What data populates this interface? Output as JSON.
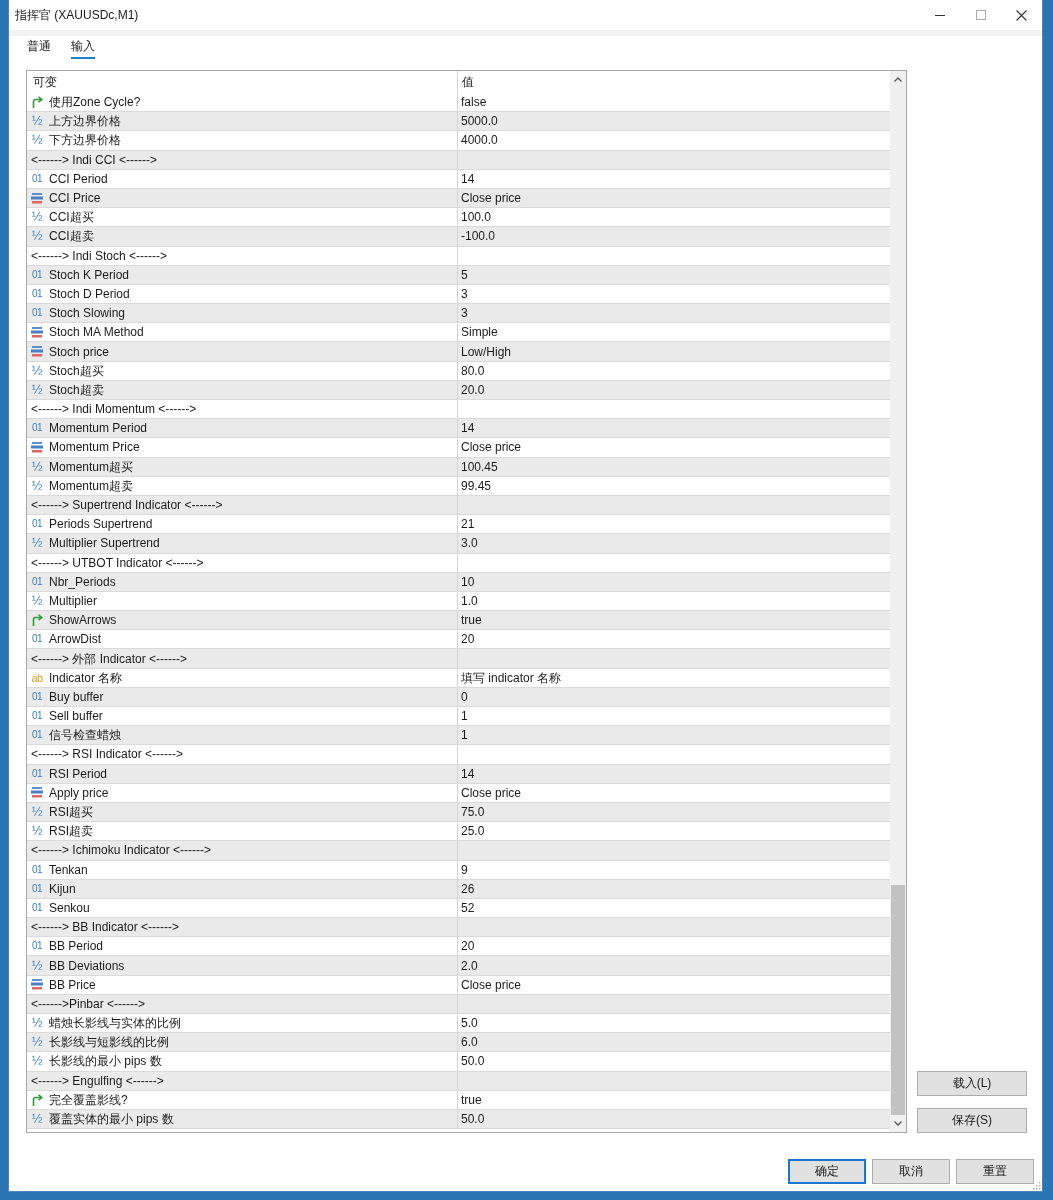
{
  "window": {
    "title": "指挥官 (XAUUSDc,M1)"
  },
  "tabs": [
    {
      "label": "普通",
      "selected": false
    },
    {
      "label": "输入",
      "selected": true
    }
  ],
  "inputs_table": {
    "columns": [
      "可变",
      "值"
    ],
    "rows": [
      {
        "kind": "bool",
        "name": "使用Zone Cycle?",
        "value": "false"
      },
      {
        "kind": "double",
        "icon": "½",
        "name": "上方边界价格",
        "value": "5000.0"
      },
      {
        "kind": "double",
        "icon": "½",
        "name": "下方边界价格",
        "value": "4000.0"
      },
      {
        "kind": "separator",
        "name": "<------> Indi CCI <------>"
      },
      {
        "kind": "int",
        "icon": "01",
        "name": "CCI Period",
        "value": "14"
      },
      {
        "kind": "enum",
        "name": "CCI Price",
        "value": "Close price"
      },
      {
        "kind": "double",
        "icon": "½",
        "name": "CCI超买",
        "value": "100.0"
      },
      {
        "kind": "double",
        "icon": "½",
        "name": "CCI超卖",
        "value": "-100.0"
      },
      {
        "kind": "separator",
        "name": "<------> Indi Stoch <------>"
      },
      {
        "kind": "int",
        "icon": "01",
        "name": "Stoch K Period",
        "value": "5"
      },
      {
        "kind": "int",
        "icon": "01",
        "name": "Stoch D Period",
        "value": "3"
      },
      {
        "kind": "int",
        "icon": "01",
        "name": "Stoch Slowing",
        "value": "3"
      },
      {
        "kind": "enum",
        "name": "Stoch MA Method",
        "value": "Simple"
      },
      {
        "kind": "enum",
        "name": "Stoch price",
        "value": "Low/High"
      },
      {
        "kind": "double",
        "icon": "½",
        "name": "Stoch超买",
        "value": "80.0"
      },
      {
        "kind": "double",
        "icon": "½",
        "name": "Stoch超卖",
        "value": "20.0"
      },
      {
        "kind": "separator",
        "name": "<------> Indi Momentum <------>"
      },
      {
        "kind": "int",
        "icon": "01",
        "name": "Momentum Period",
        "value": "14"
      },
      {
        "kind": "enum",
        "name": "Momentum Price",
        "value": "Close price"
      },
      {
        "kind": "double",
        "icon": "½",
        "name": "Momentum超买",
        "value": "100.45"
      },
      {
        "kind": "double",
        "icon": "½",
        "name": "Momentum超卖",
        "value": "99.45"
      },
      {
        "kind": "separator",
        "name": "<------> Supertrend Indicator <------>"
      },
      {
        "kind": "int",
        "icon": "01",
        "name": "Periods Supertrend",
        "value": "21"
      },
      {
        "kind": "double",
        "icon": "½",
        "name": "Multiplier Supertrend",
        "value": "3.0"
      },
      {
        "kind": "separator",
        "name": "<------> UTBOT Indicator <------>"
      },
      {
        "kind": "int",
        "icon": "01",
        "name": "Nbr_Periods",
        "value": "10"
      },
      {
        "kind": "double",
        "icon": "½",
        "name": "Multiplier",
        "value": "1.0"
      },
      {
        "kind": "bool",
        "name": "ShowArrows",
        "value": "true"
      },
      {
        "kind": "int",
        "icon": "01",
        "name": "ArrowDist",
        "value": "20"
      },
      {
        "kind": "separator",
        "name": "<------> 外部 Indicator <------>"
      },
      {
        "kind": "string",
        "icon": "ab",
        "name": "Indicator 名称",
        "value": "填写 indicator 名称"
      },
      {
        "kind": "int",
        "icon": "01",
        "name": "Buy buffer",
        "value": "0"
      },
      {
        "kind": "int",
        "icon": "01",
        "name": "Sell buffer",
        "value": "1"
      },
      {
        "kind": "int",
        "icon": "01",
        "name": "信号检查蜡烛",
        "value": "1"
      },
      {
        "kind": "separator",
        "name": "<------> RSI Indicator <------>"
      },
      {
        "kind": "int",
        "icon": "01",
        "name": "RSI Period",
        "value": "14"
      },
      {
        "kind": "enum",
        "name": "Apply price",
        "value": "Close price"
      },
      {
        "kind": "double",
        "icon": "½",
        "name": "RSI超买",
        "value": "75.0"
      },
      {
        "kind": "double",
        "icon": "½",
        "name": "RSI超卖",
        "value": "25.0"
      },
      {
        "kind": "separator",
        "name": "<------> Ichimoku Indicator <------>"
      },
      {
        "kind": "int",
        "icon": "01",
        "name": "Tenkan",
        "value": "9"
      },
      {
        "kind": "int",
        "icon": "01",
        "name": "Kijun",
        "value": "26"
      },
      {
        "kind": "int",
        "icon": "01",
        "name": "Senkou",
        "value": "52"
      },
      {
        "kind": "separator",
        "name": "<------> BB Indicator <------>"
      },
      {
        "kind": "int",
        "icon": "01",
        "name": "BB Period",
        "value": "20"
      },
      {
        "kind": "double",
        "icon": "½",
        "name": "BB Deviations",
        "value": "2.0"
      },
      {
        "kind": "enum",
        "name": "BB Price",
        "value": "Close price"
      },
      {
        "kind": "separator",
        "name": "<------>Pinbar <------>"
      },
      {
        "kind": "double",
        "icon": "½",
        "name": "蜡烛长影线与实体的比例",
        "value": "5.0"
      },
      {
        "kind": "double",
        "icon": "½",
        "name": "长影线与短影线的比例",
        "value": "6.0"
      },
      {
        "kind": "double",
        "icon": "½",
        "name": "长影线的最小 pips 数",
        "value": "50.0"
      },
      {
        "kind": "separator",
        "name": "<------> Engulfing <------>"
      },
      {
        "kind": "bool",
        "name": "完全覆盖影线?",
        "value": "true"
      },
      {
        "kind": "double",
        "icon": "½",
        "name": "覆盖实体的最小 pips 数",
        "value": "50.0"
      }
    ]
  },
  "side_buttons": [
    "载入(L)",
    "保存(S)"
  ],
  "footer_buttons": [
    {
      "label": "确定",
      "default": true
    },
    {
      "label": "取消",
      "default": false
    },
    {
      "label": "重置",
      "default": false
    }
  ]
}
